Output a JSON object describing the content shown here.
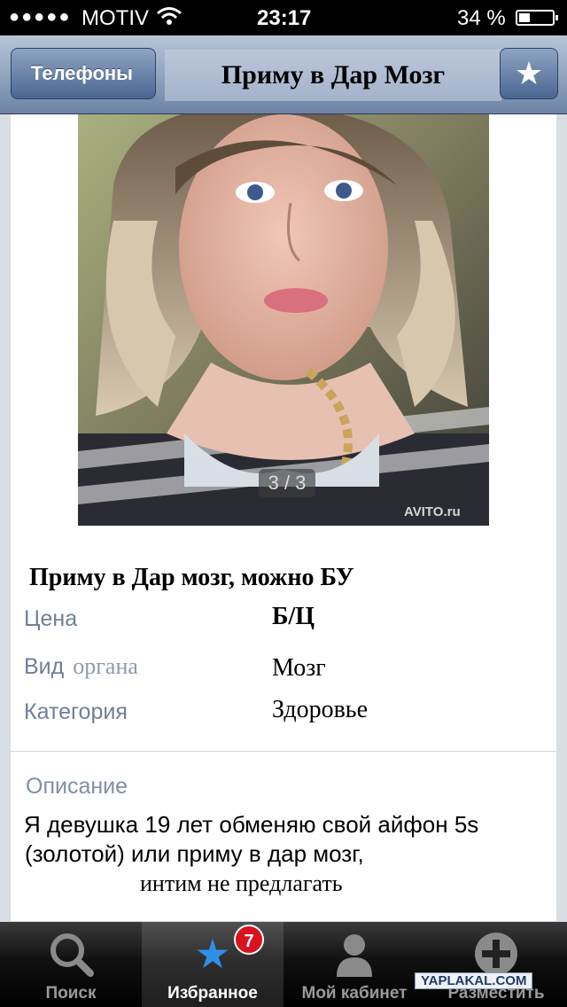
{
  "status_bar": {
    "signal": "●●●●●",
    "carrier": "MOTIV",
    "wifi_icon": "wifi-icon",
    "time": "23:17",
    "battery": "34 %",
    "battery_level": 0.34
  },
  "nav": {
    "back_label": "Телефоны",
    "title": "Приму в Дар Мозг",
    "star_icon": "star-icon"
  },
  "photo": {
    "counter": "3 / 3",
    "watermark": "AVITO.ru"
  },
  "listing": {
    "title": "Приму в Дар мозг, можно БУ",
    "price_label": "Цена",
    "price_value": "Б/Ц",
    "type_label": "Вид",
    "type_label_extra": "органа",
    "type_value": "Мозг",
    "category_label": "Категория",
    "category_value": "Здоровье"
  },
  "description": {
    "label": "Описание",
    "line1": "Я девушка 19 лет обменяю свой  айфон 5s",
    "line2": "(золотой) или приму в дар мозг,",
    "line3": "интим не предлагать"
  },
  "tabs": [
    {
      "label": "Поиск",
      "icon": "search-icon"
    },
    {
      "label": "Избранное",
      "icon": "star-icon",
      "badge": "7"
    },
    {
      "label": "Мой кабинет",
      "icon": "user-icon"
    },
    {
      "label": "Разместить",
      "icon": "plus-icon"
    }
  ],
  "site_watermark": "YAPLAKAL.COM"
}
